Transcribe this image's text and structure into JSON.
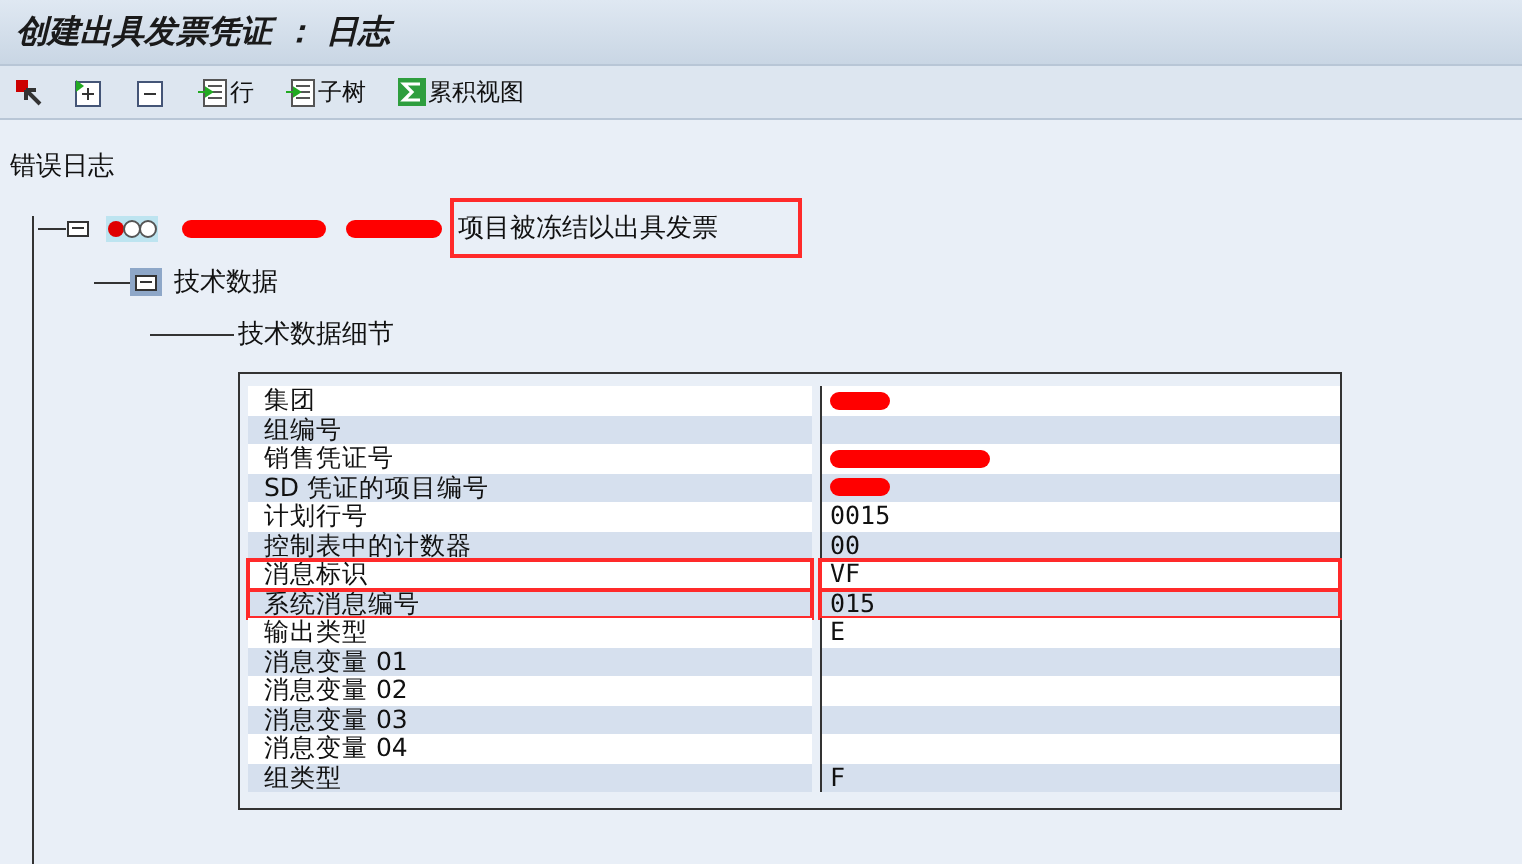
{
  "window": {
    "title": "创建出具发票凭证 ： 日志"
  },
  "toolbar": [
    {
      "kind": "icon"
    },
    {
      "kind": "icon"
    },
    {
      "kind": "icon"
    },
    {
      "kind": "labeled",
      "label": "行"
    },
    {
      "kind": "labeled",
      "label": "子树"
    },
    {
      "kind": "labeled",
      "label": "累积视图"
    }
  ],
  "tree": {
    "label": "错误日志",
    "children": [
      {
        "kind": "message",
        "color": "#e00000",
        "redacted": true,
        "message": "项目被冻结以出具发票",
        "highlighted": true,
        "children": [
          {
            "kind": "folder",
            "label": "技术数据",
            "selected": true,
            "children": [
              {
                "kind": "detail",
                "label": "技术数据细节"
              }
            ]
          }
        ]
      }
    ]
  },
  "details": {
    "rows": [
      {
        "label": "集团",
        "redacted": true,
        "highlighted": false
      },
      {
        "label": "组编号",
        "highlighted": false
      },
      {
        "label": "销售凭证号",
        "redacted": true,
        "highlighted": false
      },
      {
        "label": "SD 凭证的项目编号",
        "redacted": true,
        "highlighted": false
      },
      {
        "label": "计划行号",
        "value": "0015",
        "highlighted": false
      },
      {
        "label": "控制表中的计数器",
        "value": "00",
        "highlighted": false
      },
      {
        "label": "消息标识",
        "value": "VF",
        "highlighted": true
      },
      {
        "label": "系统消息编号",
        "value": "015",
        "highlighted": true
      },
      {
        "label": "输出类型",
        "value": "E",
        "highlighted": false
      },
      {
        "label": "消息变量 01",
        "highlighted": false
      },
      {
        "label": "消息变量 02",
        "highlighted": false
      },
      {
        "label": "消息变量 03",
        "highlighted": false
      },
      {
        "label": "消息变量 04",
        "highlighted": false
      },
      {
        "label": "组类型",
        "value": "F",
        "highlighted": false
      }
    ]
  }
}
